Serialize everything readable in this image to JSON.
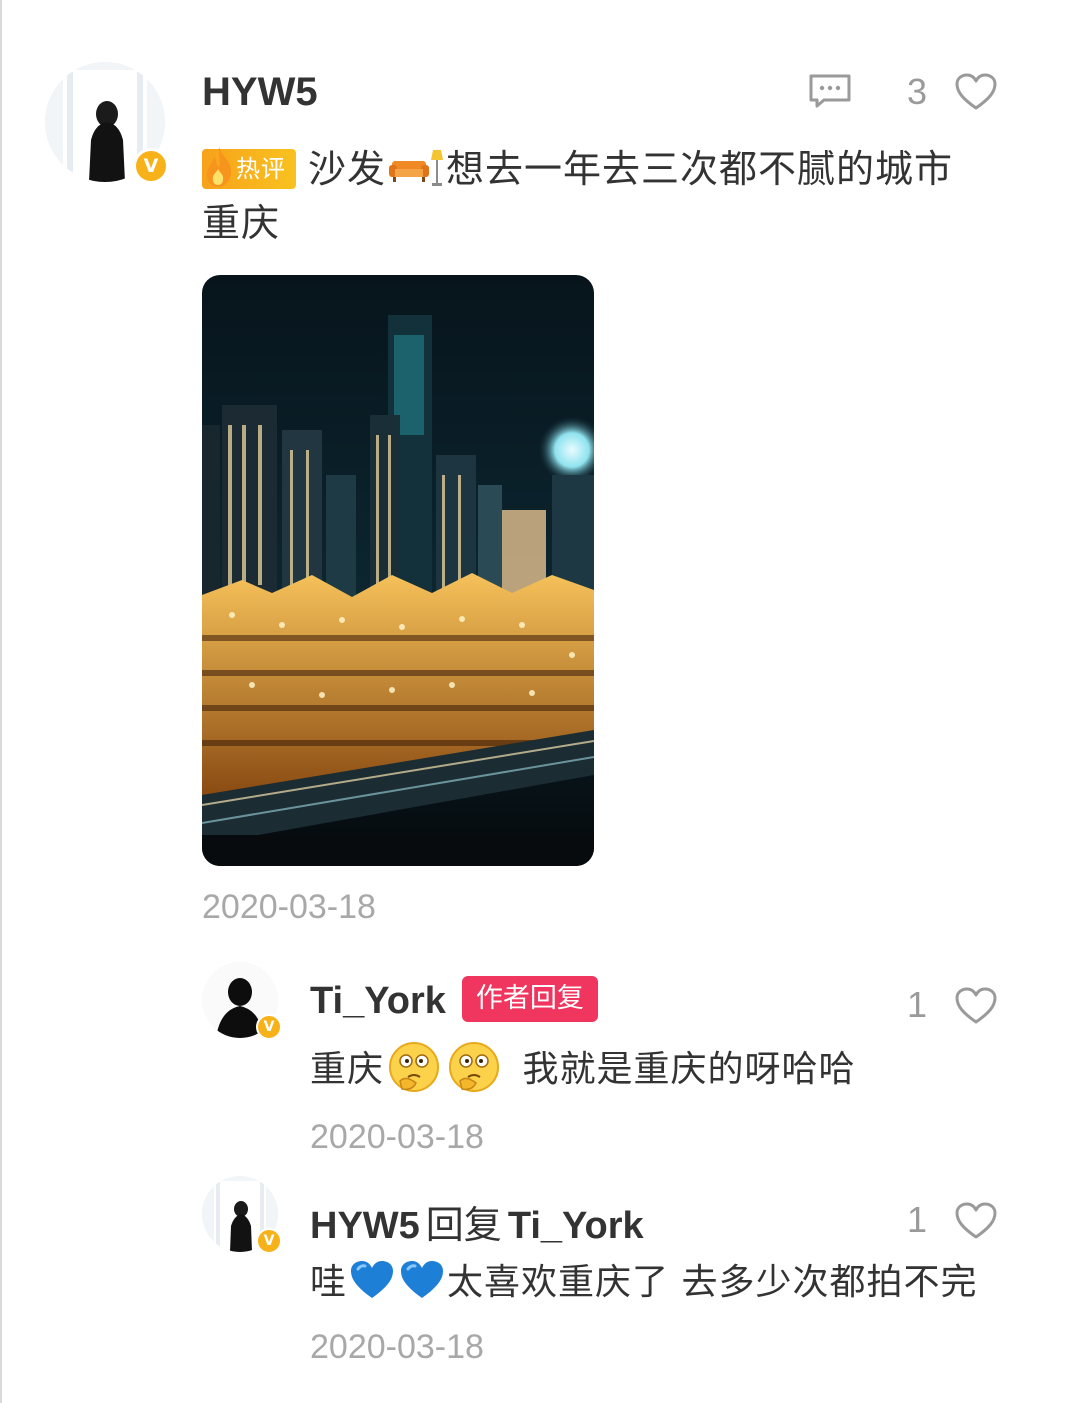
{
  "comment": {
    "author": "HYW5",
    "verified_badge": "V",
    "hot_label": "热评",
    "text_part1": "沙发",
    "text_part2": "想去一年去三次都不腻的城市",
    "text_line2": "重庆",
    "like_count": "3",
    "date": "2020-03-18",
    "icons": [
      "comment-icon",
      "heart-icon",
      "sofa-emoji",
      "lamp-emoji",
      "flame-icon"
    ]
  },
  "replies": [
    {
      "author": "Ti_York",
      "author_tag": "作者回复",
      "verified_badge": "V",
      "text_part1": "重庆",
      "text_part2": "我就是重庆的呀哈哈",
      "like_count": "1",
      "date": "2020-03-18",
      "emoji": "thinking-face-emoji"
    },
    {
      "author": "HYW5",
      "reply_keyword": "回复",
      "reply_to": "Ti_York",
      "verified_badge": "V",
      "text_part1": "哇",
      "text_part2": "太喜欢重庆了 去多少次都拍不完",
      "like_count": "1",
      "date": "2020-03-18",
      "emoji": "blue-heart-emoji"
    }
  ],
  "colors": {
    "verified": "#f7b21a",
    "author_tag": "#f0355f",
    "hot_badge": "#f8b21d",
    "muted": "#a8a8a8"
  }
}
